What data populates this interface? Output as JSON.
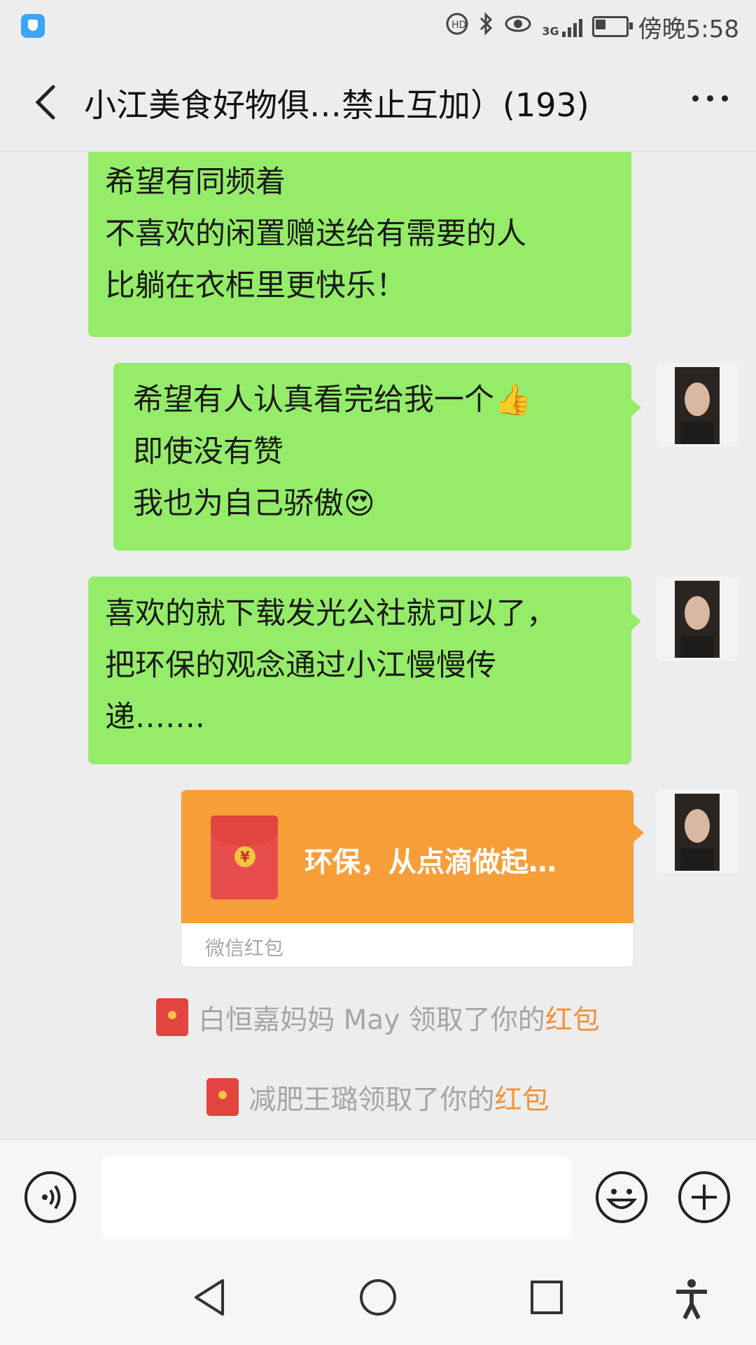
{
  "status_bar": {
    "time": "傍晚5:58",
    "network": "3G",
    "icons": [
      "shield-app-icon",
      "hd-call-icon",
      "bluetooth-icon",
      "eye-comfort-icon",
      "signal-icon",
      "battery-icon"
    ]
  },
  "header": {
    "title": "小江美食好物俱…禁止互加）(193)",
    "back_icon": "back-arrow-icon",
    "more_icon": "more-dots-icon"
  },
  "messages": [
    {
      "type": "text",
      "sender": "self",
      "lines": [
        "希望有同频着",
        "不喜欢的闲置赠送给有需要的人",
        "比躺在衣柜里更快乐！"
      ]
    },
    {
      "type": "text",
      "sender": "self",
      "lines": [
        "希望有人认真看完给我一个👍",
        "即使没有赞",
        "我也为自己骄傲😍"
      ]
    },
    {
      "type": "text",
      "sender": "self",
      "lines": [
        "喜欢的就下载发光公社就可以了，",
        "把环保的观念通过小江慢慢传",
        "递……."
      ]
    },
    {
      "type": "red_packet",
      "sender": "self",
      "title": "环保，从点滴做起…",
      "footer": "微信红包",
      "color": "#f79e39"
    }
  ],
  "notices": [
    {
      "prefix": "白恒嘉妈妈 May 领取了你的",
      "link": "红包"
    },
    {
      "prefix": "减肥王璐领取了你的",
      "link": "红包"
    }
  ],
  "input_bar": {
    "value": "",
    "voice_icon": "voice-icon",
    "emoji_icon": "emoji-icon",
    "plus_icon": "plus-icon"
  },
  "system_nav": [
    "back-triangle-icon",
    "home-circle-icon",
    "recents-square-icon",
    "accessibility-icon"
  ],
  "colors": {
    "self_bubble": "#95ec69",
    "background": "#ededed",
    "link": "#f0923a"
  }
}
